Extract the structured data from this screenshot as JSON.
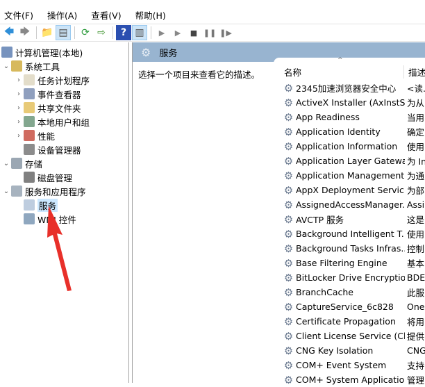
{
  "menu": [
    "文件(F)",
    "操作(A)",
    "查看(V)",
    "帮助(H)"
  ],
  "toolbar": {
    "icons": [
      "back-icon",
      "forward-icon",
      "up-folder-icon",
      "show-hide-tree-icon",
      "refresh-icon",
      "export-list-icon",
      "help-icon",
      "show-hide-action-pane-icon",
      "start-service-icon",
      "start-service-alt-icon",
      "stop-service-icon",
      "pause-service-icon",
      "restart-service-icon"
    ]
  },
  "tree": [
    {
      "label": "计算机管理(本地)",
      "level": 0,
      "chev": ""
    },
    {
      "label": "系统工具",
      "level": 1,
      "chev": "v"
    },
    {
      "label": "任务计划程序",
      "level": 2,
      "chev": ">"
    },
    {
      "label": "事件查看器",
      "level": 2,
      "chev": ">"
    },
    {
      "label": "共享文件夹",
      "level": 2,
      "chev": ">"
    },
    {
      "label": "本地用户和组",
      "level": 2,
      "chev": ">"
    },
    {
      "label": "性能",
      "level": 2,
      "chev": ">"
    },
    {
      "label": "设备管理器",
      "level": 2,
      "chev": ""
    },
    {
      "label": "存储",
      "level": 1,
      "chev": "v"
    },
    {
      "label": "磁盘管理",
      "level": 2,
      "chev": ""
    },
    {
      "label": "服务和应用程序",
      "level": 1,
      "chev": "v"
    },
    {
      "label": "服务",
      "level": 2,
      "chev": "",
      "selected": true
    },
    {
      "label": "WMI 控件",
      "level": 2,
      "chev": ""
    }
  ],
  "panel": {
    "title": "服务",
    "description": "选择一个项目来查看它的描述。"
  },
  "columns": {
    "name": "名称",
    "desc": "描述"
  },
  "services": [
    {
      "name": "2345加速浏览器安全中心",
      "desc": "<读..."
    },
    {
      "name": "ActiveX Installer (AxInstSV)",
      "desc": "为从"
    },
    {
      "name": "App Readiness",
      "desc": "当用"
    },
    {
      "name": "Application Identity",
      "desc": "确定"
    },
    {
      "name": "Application Information",
      "desc": "使用"
    },
    {
      "name": "Application Layer Gatewa...",
      "desc": "为 In"
    },
    {
      "name": "Application Management",
      "desc": "为通"
    },
    {
      "name": "AppX Deployment Servic...",
      "desc": "为部"
    },
    {
      "name": "AssignedAccessManager...",
      "desc": "Assi"
    },
    {
      "name": "AVCTP 服务",
      "desc": "这是"
    },
    {
      "name": "Background Intelligent T...",
      "desc": "使用"
    },
    {
      "name": "Background Tasks Infras...",
      "desc": "控制"
    },
    {
      "name": "Base Filtering Engine",
      "desc": "基本"
    },
    {
      "name": "BitLocker Drive Encryptio...",
      "desc": "BDE"
    },
    {
      "name": "BranchCache",
      "desc": "此服"
    },
    {
      "name": "CaptureService_6c828",
      "desc": "One"
    },
    {
      "name": "Certificate Propagation",
      "desc": "将用"
    },
    {
      "name": "Client License Service (Cli...",
      "desc": "提供"
    },
    {
      "name": "CNG Key Isolation",
      "desc": "CNG"
    },
    {
      "name": "COM+ Event System",
      "desc": "支持"
    },
    {
      "name": "COM+ System Application",
      "desc": "管理"
    }
  ],
  "colors": {
    "header_bar": "#98b4d0",
    "selection": "#cce8ff",
    "arrow": "#e8302a"
  }
}
